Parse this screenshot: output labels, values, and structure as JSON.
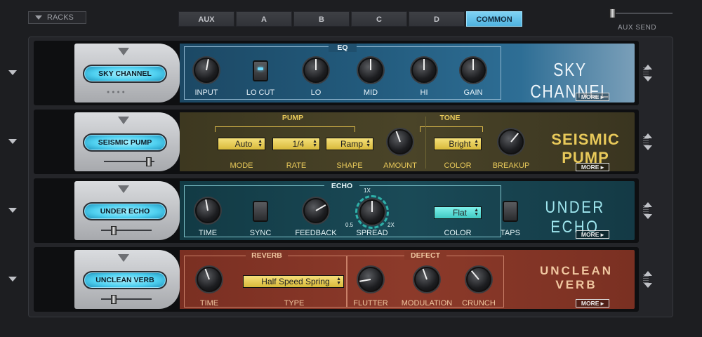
{
  "header": {
    "racks_label": "RACKS",
    "tabs": [
      {
        "label": "AUX"
      },
      {
        "label": "A"
      },
      {
        "label": "B"
      },
      {
        "label": "C"
      },
      {
        "label": "D"
      },
      {
        "label": "COMMON",
        "active": true
      }
    ],
    "aux_send_label": "AUX SEND"
  },
  "racks": [
    {
      "name": "SKY CHANNEL",
      "title": "SKY CHANNEL",
      "section": "EQ",
      "controls": [
        "INPUT",
        "LO CUT",
        "LO",
        "MID",
        "HI",
        "GAIN"
      ],
      "more": "MORE ▸"
    },
    {
      "name": "SEISMIC PUMP",
      "title": "SEISMIC PUMP",
      "section_a": "PUMP",
      "section_b": "TONE",
      "mode": "Auto",
      "rate": "1/4",
      "shape": "Ramp",
      "color": "Bright",
      "controls": [
        "MODE",
        "RATE",
        "SHAPE",
        "AMOUNT",
        "COLOR",
        "BREAKUP"
      ],
      "more": "MORE ▸"
    },
    {
      "name": "UNDER ECHO",
      "title": "UNDER ECHO",
      "section": "ECHO",
      "color": "Flat",
      "spread_marks": [
        "1X",
        "0.5",
        "2X"
      ],
      "controls": [
        "TIME",
        "SYNC",
        "FEEDBACK",
        "SPREAD",
        "COLOR",
        "TAPS"
      ],
      "more": "MORE ▸"
    },
    {
      "name": "UNCLEAN VERB",
      "title_line1": "UNCLEAN",
      "title_line2": "VERB",
      "section_a": "REVERB",
      "section_b": "DEFECT",
      "type": "Half Speed Spring",
      "controls": [
        "TIME",
        "TYPE",
        "FLUTTER",
        "MODULATION",
        "CRUNCH"
      ],
      "more": "MORE ▸"
    }
  ],
  "colors": {
    "tab_active": "#5fc0e8",
    "pill": "#4fd0f0",
    "pump_accent": "#e8c95a",
    "echo_accent": "#9fe6ee",
    "verb_accent": "#f0c7a0"
  },
  "icons": [
    "chevron-down-icon",
    "chevron-up-icon",
    "grip-icon"
  ]
}
